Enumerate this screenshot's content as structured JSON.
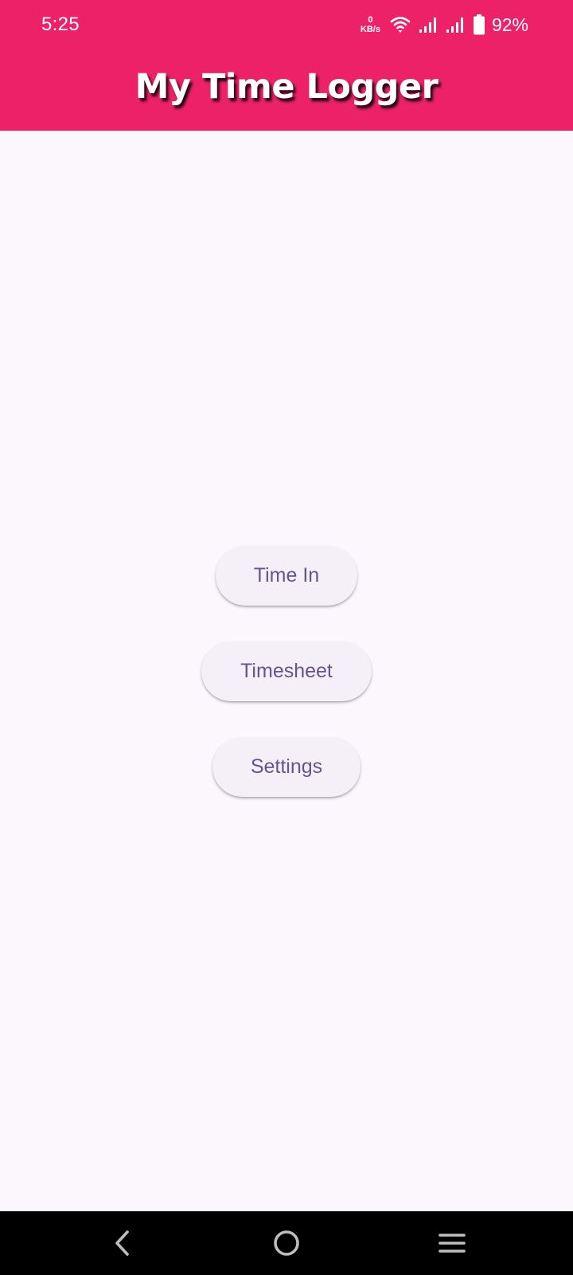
{
  "status_bar": {
    "time": "5:25",
    "net_speed_value": "0",
    "net_speed_unit": "KB/s",
    "battery_percent": "92%",
    "icons": [
      "wifi-icon",
      "signal-icon",
      "signal-icon",
      "battery-icon"
    ]
  },
  "app_bar": {
    "title": "My Time Logger",
    "color": "#ec2167"
  },
  "main": {
    "buttons": [
      {
        "label": "Time In"
      },
      {
        "label": "Timesheet"
      },
      {
        "label": "Settings"
      }
    ],
    "button_text_color": "#65558f",
    "button_background": "#f5f0f8",
    "background": "#fcf7fd"
  },
  "nav_bar": {
    "icons": [
      "back-icon",
      "home-icon",
      "recents-icon"
    ]
  }
}
